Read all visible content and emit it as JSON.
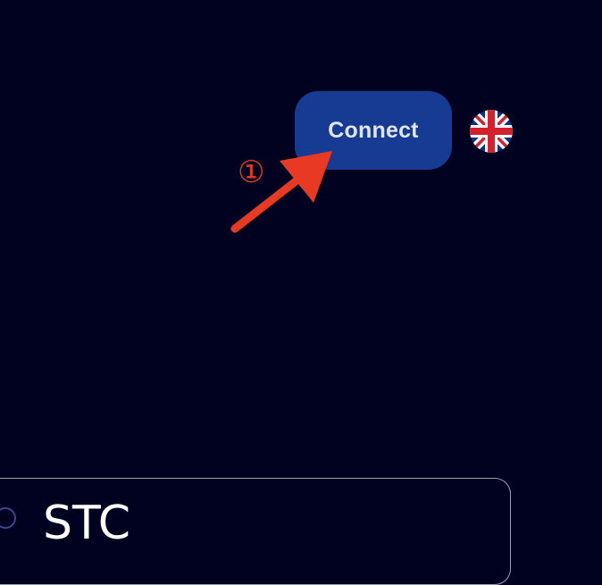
{
  "header": {
    "connect_label": "Connect",
    "language_icon": "uk-flag-icon"
  },
  "annotation": {
    "step_number": "①",
    "arrow_icon": "annotation-arrow-icon",
    "color": "#e83a22"
  },
  "card": {
    "title": "STC"
  },
  "colors": {
    "background": "#00021f",
    "connect_button": "#173a93",
    "card_border": "#9aa0b4"
  }
}
